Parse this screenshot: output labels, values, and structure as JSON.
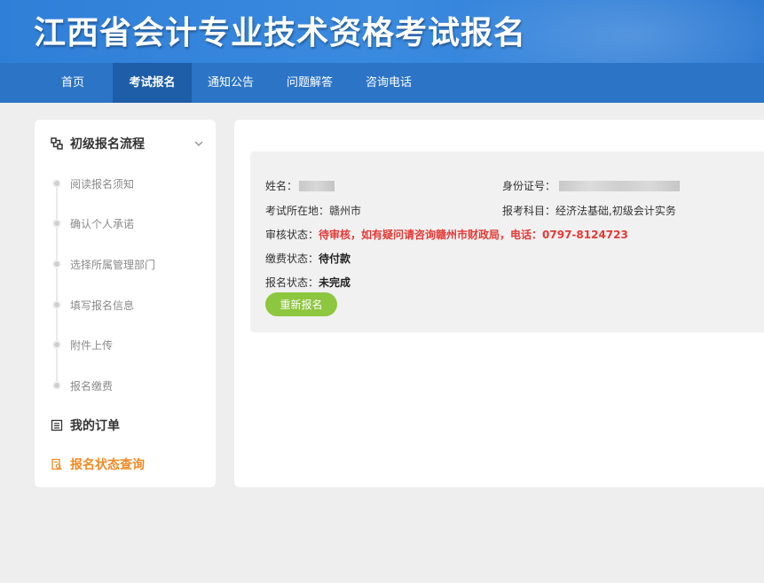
{
  "header": {
    "title": "江西省会计专业技术资格考试报名"
  },
  "nav": {
    "items": [
      {
        "label": "首页",
        "active": false
      },
      {
        "label": "考试报名",
        "active": true
      },
      {
        "label": "通知公告",
        "active": false
      },
      {
        "label": "问题解答",
        "active": false
      },
      {
        "label": "咨询电话",
        "active": false
      }
    ]
  },
  "sidebar": {
    "section_title": "初级报名流程",
    "steps": [
      {
        "label": "阅读报名须知"
      },
      {
        "label": "确认个人承诺"
      },
      {
        "label": "选择所属管理部门"
      },
      {
        "label": "填写报名信息"
      },
      {
        "label": "附件上传"
      },
      {
        "label": "报名缴费"
      }
    ],
    "my_orders": "我的订单",
    "status_query": "报名状态查询"
  },
  "info": {
    "name_label": "姓名：",
    "id_label": "身份证号：",
    "location_label": "考试所在地：",
    "location_value": "赣州市",
    "subjects_label": "报考科目：",
    "subjects_value": "经济法基础,初级会计实务",
    "review_label": "审核状态：",
    "review_value": "待审核，如有疑问请咨询赣州市财政局，电话：0797-8124723",
    "payment_label": "缴费状态：",
    "payment_value": "待付款",
    "signup_label": "报名状态：",
    "signup_value": "未完成"
  },
  "actions": {
    "retry_label": "重新报名"
  },
  "colors": {
    "banner": "#2f7fd8",
    "nav": "#2b74c6",
    "nav_active": "#1e5ea8",
    "accent_orange": "#f08a24",
    "alert_red": "#e53935",
    "button_green": "#8dc63f"
  }
}
